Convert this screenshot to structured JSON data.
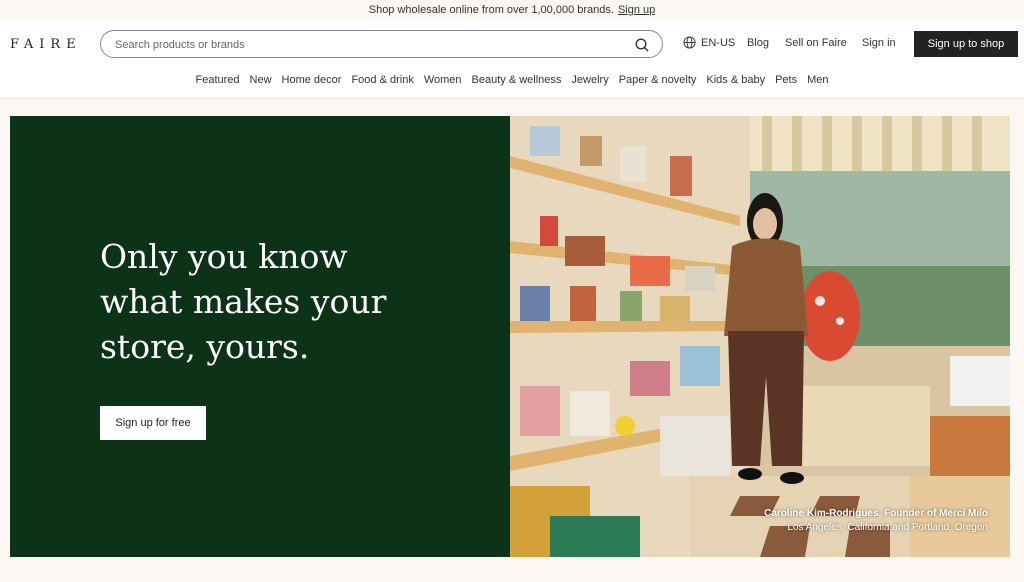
{
  "announcement": {
    "text": "Shop wholesale online from over 1,00,000 brands.",
    "link": "Sign up"
  },
  "header": {
    "logo": "FAIRE",
    "search_placeholder": "Search products or brands",
    "locale": "EN-US",
    "links": {
      "blog": "Blog",
      "sell": "Sell on Faire",
      "sign_in": "Sign in"
    },
    "cta": "Sign up to shop"
  },
  "categories": [
    "Featured",
    "New",
    "Home decor",
    "Food & drink",
    "Women",
    "Beauty & wellness",
    "Jewelry",
    "Paper & novelty",
    "Kids & baby",
    "Pets",
    "Men"
  ],
  "hero": {
    "title": "Only you know what makes your store, yours.",
    "button": "Sign up for free",
    "caption_name": "Caroline Kim-Rodrigues, Founder of Merci Milo",
    "caption_location": "Los Angeles, California and Portland, Oregon"
  },
  "colors": {
    "hero_green": "#0c3317",
    "page_bg": "#fbf7f3",
    "button_dark": "#222222"
  }
}
